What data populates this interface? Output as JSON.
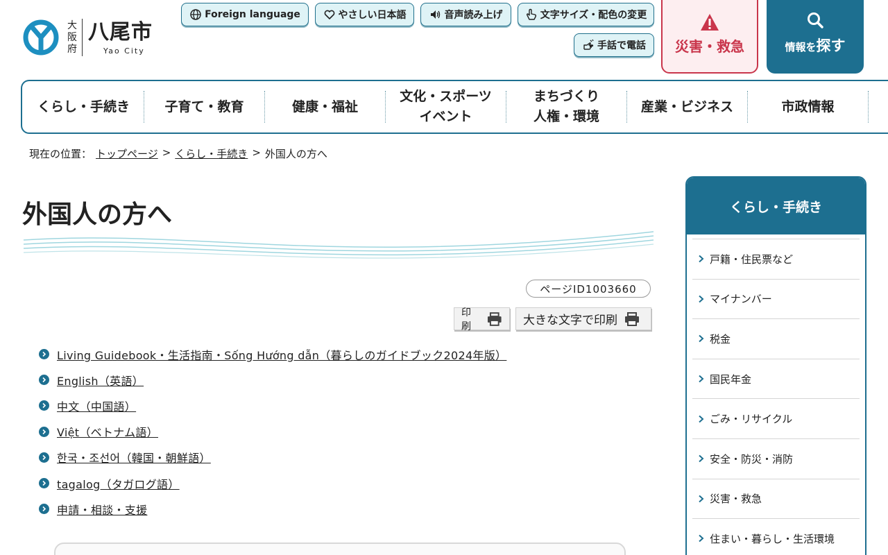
{
  "header": {
    "logo": {
      "prefecture": "大阪府",
      "name": "八尾市",
      "sub": "Yao City",
      "mark_color": "#1d8fc0"
    },
    "tools": [
      {
        "label": "Foreign language",
        "icon": "globe-icon"
      },
      {
        "label": "やさしい日本語",
        "icon": "heart-icon"
      },
      {
        "label": "音声読み上げ",
        "icon": "speaker-icon"
      },
      {
        "label": "文字サイズ・配色の変更",
        "icon": "cursor-hand-icon"
      },
      {
        "label": "手話で電話",
        "icon": "sign-language-icon"
      }
    ],
    "emergency_label": "災害・救急",
    "search_label_small": "情報を",
    "search_label_big": "探す"
  },
  "global_nav": [
    {
      "label": "くらし・手続き"
    },
    {
      "label": "子育て・教育"
    },
    {
      "label": "健康・福祉"
    },
    {
      "label": "文化・スポーツ\nイベント"
    },
    {
      "label": "まちづくり\n人権・環境"
    },
    {
      "label": "産業・ビジネス"
    },
    {
      "label": "市政情報"
    }
  ],
  "breadcrumb": {
    "prefix": "現在の位置：",
    "items": [
      "トップページ",
      "くらし・手続き",
      "外国人の方へ"
    ],
    "separator": ">"
  },
  "main": {
    "title": "外国人の方へ",
    "page_id": "ページID1003660",
    "print_label": "印刷",
    "print_large_label": "大きな文字で印刷",
    "links": [
      "Living Guidebook・生活指南・Sống Hướng dẫn（暮らしのガイドブック2024年版）",
      "English（英語）",
      "中文（中国語）",
      "Việt（ベトナム語）",
      "한국・조선어（韓国・朝鮮語）",
      "tagalog（タガログ語）",
      "申請・相談・支援"
    ]
  },
  "side_nav": {
    "title": "くらし・手続き",
    "items": [
      "戸籍・住民票など",
      "マイナンバー",
      "税金",
      "国民年金",
      "ごみ・リサイクル",
      "安全・防災・消防",
      "災害・救急",
      "住まい・暮らし・生活環境"
    ]
  },
  "colors": {
    "brand": "#1d6f90",
    "emergency": "#c9354b",
    "tool_bg": "#dff3f6"
  }
}
